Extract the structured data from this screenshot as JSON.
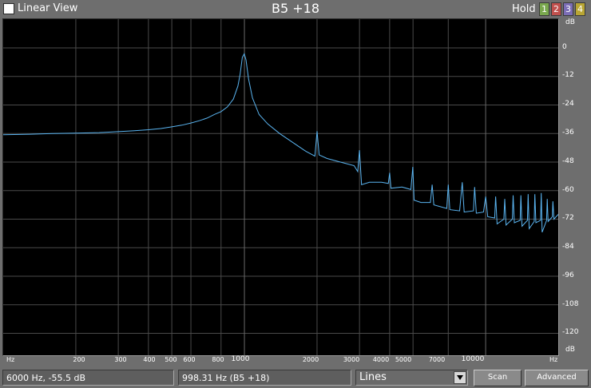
{
  "header": {
    "linear_view_label": "Linear View",
    "linear_view_checked": false,
    "note_title": "B5 +18",
    "hold_label": "Hold",
    "hold_buttons": [
      "1",
      "2",
      "3",
      "4"
    ],
    "hold_colors": [
      "#7aa84e",
      "#c0504d",
      "#7b6db5",
      "#b9a634"
    ]
  },
  "db_axis": {
    "unit": "dB",
    "ticks": [
      "0",
      "-12",
      "-24",
      "-36",
      "-48",
      "-60",
      "-72",
      "-84",
      "-96",
      "-108",
      "-120"
    ]
  },
  "freq_axis": {
    "unit": "Hz",
    "labels": [
      "200",
      "300",
      "400",
      "500",
      "600",
      "800",
      "1000",
      "2000",
      "3000",
      "4000",
      "5000",
      "7000",
      "10000"
    ]
  },
  "status": {
    "cursor_readout": "6000 Hz,  -55.5 dB",
    "peak_readout": "998.31 Hz (B5 +18)",
    "view_mode": "Lines",
    "scan_label": "Scan",
    "advanced_label": "Advanced"
  },
  "colors": {
    "trace": "#5ab4f0",
    "grid": "#4a4a4a",
    "background": "#000000"
  },
  "chart_data": {
    "type": "line",
    "x_scale": "log",
    "x_unit": "Hz",
    "y_unit": "dB",
    "xlim": [
      100,
      20000
    ],
    "ylim": [
      -130,
      10
    ],
    "grid": true,
    "series": [
      {
        "points": [
          [
            100,
            -36.5
          ],
          [
            130,
            -36.3
          ],
          [
            160,
            -36.0
          ],
          [
            200,
            -35.8
          ],
          [
            250,
            -35.6
          ],
          [
            300,
            -35.2
          ],
          [
            350,
            -34.8
          ],
          [
            400,
            -34.4
          ],
          [
            450,
            -33.9
          ],
          [
            500,
            -33.2
          ],
          [
            550,
            -32.5
          ],
          [
            600,
            -31.6
          ],
          [
            650,
            -30.6
          ],
          [
            700,
            -29.5
          ],
          [
            750,
            -28.0
          ],
          [
            800,
            -26.8
          ],
          [
            850,
            -24.8
          ],
          [
            900,
            -21.5
          ],
          [
            940,
            -16.0
          ],
          [
            960,
            -11.0
          ],
          [
            980,
            -4.0
          ],
          [
            998,
            -2.5
          ],
          [
            1015,
            -5.0
          ],
          [
            1040,
            -13.0
          ],
          [
            1080,
            -21.0
          ],
          [
            1150,
            -28.0
          ],
          [
            1250,
            -32.0
          ],
          [
            1400,
            -36.0
          ],
          [
            1600,
            -40.0
          ],
          [
            1800,
            -43.5
          ],
          [
            1960,
            -45.5
          ],
          [
            2000,
            -35.0
          ],
          [
            2040,
            -45.0
          ],
          [
            2200,
            -46.5
          ],
          [
            2500,
            -48.0
          ],
          [
            2850,
            -49.5
          ],
          [
            2950,
            -52.0
          ],
          [
            3000,
            -43.0
          ],
          [
            3060,
            -57.5
          ],
          [
            3300,
            -56.5
          ],
          [
            3700,
            -56.5
          ],
          [
            3950,
            -57.0
          ],
          [
            4000,
            -52.5
          ],
          [
            4050,
            -59.0
          ],
          [
            4500,
            -58.5
          ],
          [
            4900,
            -59.5
          ],
          [
            4990,
            -50.0
          ],
          [
            5050,
            -64.0
          ],
          [
            5400,
            -65.0
          ],
          [
            5900,
            -65.0
          ],
          [
            6000,
            -57.5
          ],
          [
            6100,
            -66.0
          ],
          [
            6900,
            -67.5
          ],
          [
            7000,
            -57.5
          ],
          [
            7100,
            -68.0
          ],
          [
            7800,
            -68.5
          ],
          [
            8000,
            -56.5
          ],
          [
            8150,
            -69.0
          ],
          [
            8900,
            -68.5
          ],
          [
            9000,
            -58.5
          ],
          [
            9150,
            -69.5
          ],
          [
            9800,
            -69.0
          ],
          [
            10000,
            -62.5
          ],
          [
            10200,
            -71.0
          ],
          [
            10900,
            -71.5
          ],
          [
            11000,
            -62.5
          ],
          [
            11150,
            -74.0
          ],
          [
            11900,
            -72.0
          ],
          [
            12000,
            -63.5
          ],
          [
            12150,
            -74.5
          ],
          [
            12900,
            -72.0
          ],
          [
            13000,
            -62.0
          ],
          [
            13150,
            -73.5
          ],
          [
            13900,
            -72.5
          ],
          [
            14000,
            -62.0
          ],
          [
            14150,
            -75.0
          ],
          [
            14900,
            -72.5
          ],
          [
            15000,
            -61.5
          ],
          [
            15150,
            -76.0
          ],
          [
            15900,
            -73.0
          ],
          [
            16000,
            -61.5
          ],
          [
            16150,
            -73.5
          ],
          [
            16900,
            -72.5
          ],
          [
            17000,
            -61.0
          ],
          [
            17150,
            -77.5
          ],
          [
            17900,
            -72.5
          ],
          [
            18000,
            -63.5
          ],
          [
            18150,
            -73.0
          ],
          [
            18900,
            -71.0
          ],
          [
            19000,
            -64.5
          ],
          [
            19200,
            -72.0
          ],
          [
            20000,
            -70.0
          ]
        ]
      }
    ]
  }
}
